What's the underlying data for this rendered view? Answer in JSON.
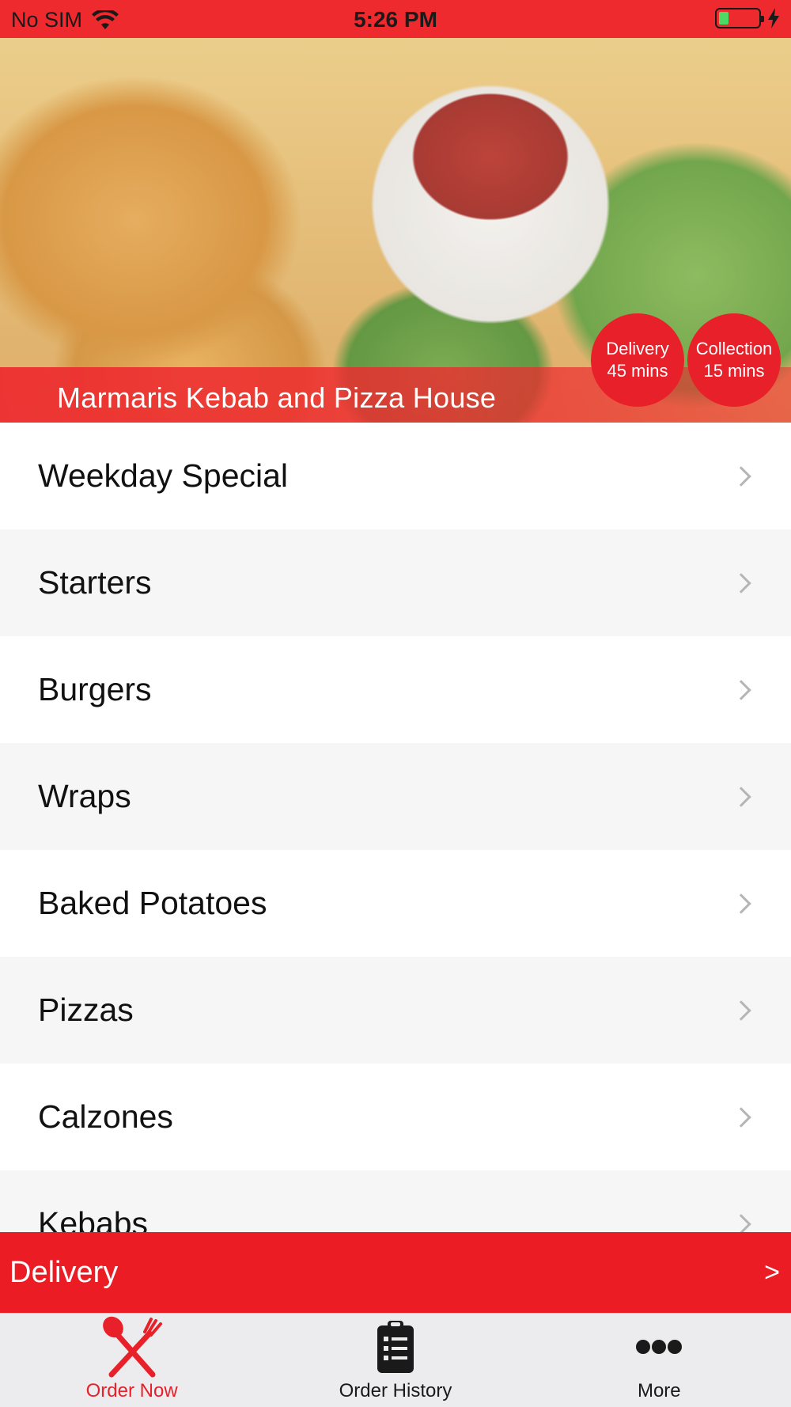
{
  "status_bar": {
    "carrier": "No SIM",
    "time": "5:26 PM",
    "wifi_icon": "wifi-icon",
    "battery_level": 0.25,
    "charging_icon": "bolt-icon"
  },
  "hero": {
    "restaurant_name": "Marmaris Kebab and Pizza House",
    "delivery_badge": {
      "label": "Delivery",
      "time": "45 mins"
    },
    "collection_badge": {
      "label": "Collection",
      "time": "15 mins"
    }
  },
  "menu": {
    "items": [
      {
        "label": "Weekday Special"
      },
      {
        "label": "Starters"
      },
      {
        "label": "Burgers"
      },
      {
        "label": "Wraps"
      },
      {
        "label": "Baked Potatoes"
      },
      {
        "label": "Pizzas"
      },
      {
        "label": "Calzones"
      },
      {
        "label": "Kebabs"
      }
    ]
  },
  "delivery_bar": {
    "label": "Delivery",
    "arrow": ">"
  },
  "tabs": [
    {
      "label": "Order Now",
      "icon": "fork-knife-icon",
      "active": true
    },
    {
      "label": "Order History",
      "icon": "clipboard-icon",
      "active": false
    },
    {
      "label": "More",
      "icon": "more-dots-icon",
      "active": false
    }
  ],
  "colors": {
    "brand_red": "#ec1c24",
    "list_alt_bg": "#f6f6f7",
    "tab_bar_bg": "#ececee"
  }
}
